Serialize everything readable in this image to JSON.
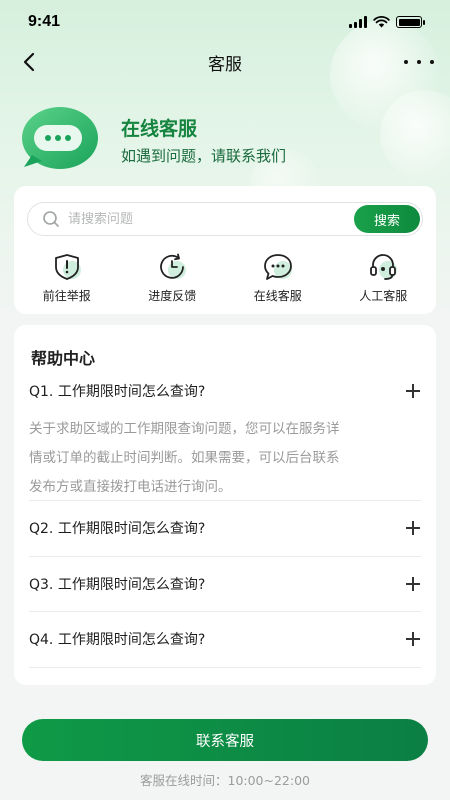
{
  "status_bar": {
    "time": "9:41"
  },
  "nav": {
    "title": "客服"
  },
  "hero": {
    "title": "在线客服",
    "subtitle": "如遇到问题，请联系我们"
  },
  "search": {
    "placeholder": "请搜索问题",
    "button_label": "搜索"
  },
  "quick_actions": [
    {
      "label": "前往举报",
      "icon": "report-shield-icon"
    },
    {
      "label": "进度反馈",
      "icon": "progress-clock-icon"
    },
    {
      "label": "在线客服",
      "icon": "chat-bubble-icon"
    },
    {
      "label": "人工客服",
      "icon": "headset-icon"
    }
  ],
  "help_center": {
    "title": "帮助中心",
    "faqs": [
      {
        "question": "Q1. 工作期限时间怎么查询?",
        "answer_lines": [
          "关于求助区域的工作期限查询问题，您可以在服务详",
          "情或订单的截止时间判断。如果需要，可以后台联系",
          "发布方或直接拨打电话进行询问。"
        ]
      },
      {
        "question": "Q2. 工作期限时间怎么查询?"
      },
      {
        "question": "Q3. 工作期限时间怎么查询?"
      },
      {
        "question": "Q4. 工作期限时间怎么查询?"
      }
    ]
  },
  "footer": {
    "contact_button": "联系客服",
    "service_hours": "客服在线时间：10:00~22:00"
  },
  "colors": {
    "brand_green": "#15843f",
    "button_green": "#0f9a46"
  }
}
